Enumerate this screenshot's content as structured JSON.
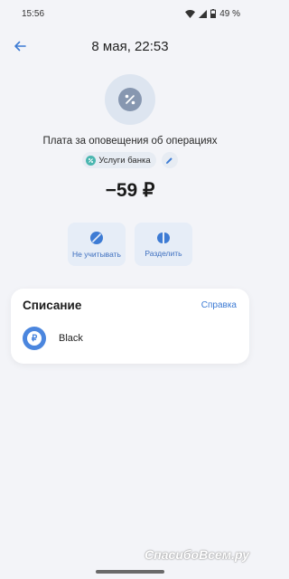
{
  "status_bar": {
    "time": "15:56",
    "battery": "49 %",
    "icons": [
      "wifi-icon",
      "signal-icon",
      "battery-icon"
    ]
  },
  "header": {
    "back_icon": "back-arrow-icon",
    "title": "8 мая, 22:53"
  },
  "operation": {
    "category_icon": "percent-icon",
    "title": "Плата за оповещения об операциях",
    "tag_label": "Услуги банка",
    "tag_icon": "bank-services-icon",
    "edit_icon": "pencil-icon",
    "amount": "−59 ₽"
  },
  "actions": [
    {
      "label": "Не учитывать",
      "icon": "eye-off-icon"
    },
    {
      "label": "Разделить",
      "icon": "split-icon"
    }
  ],
  "card": {
    "title": "Списание",
    "link": "Справка",
    "account_name": "Black",
    "account_icon": "ruble-icon",
    "account_icon_glyph": "₽"
  },
  "watermark": "СпасибоВсем.ру",
  "colors": {
    "background": "#f3f4f8",
    "accent": "#3d7bd4",
    "action_bg": "#e6edf7",
    "tag_icon": "#4ab6b0"
  }
}
